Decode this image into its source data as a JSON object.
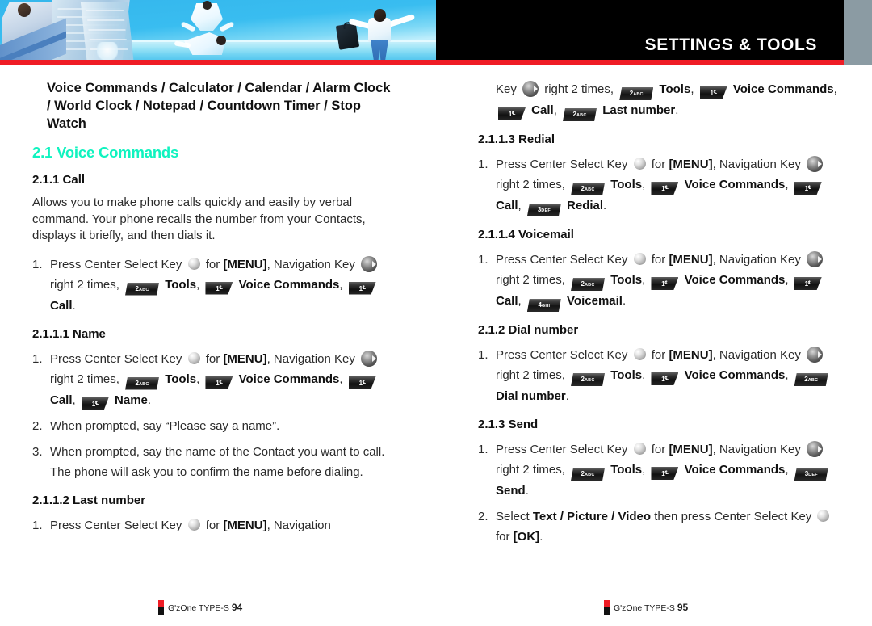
{
  "header": {
    "section_title": "SETTINGS & TOOLS",
    "accent_red": "#ef1c25",
    "band_black": "#000000",
    "band_gray": "#8b9ba3"
  },
  "theme": {
    "heading_green": "#0ff3bf",
    "body_text": "#2b2b2b"
  },
  "left_column": {
    "intro": "Voice Commands / Calculator / Calendar / Alarm Clock  / World Clock / Notepad / Countdown Timer / Stop Watch",
    "section_heading": "2.1 Voice Commands",
    "call": {
      "heading": "2.1.1 Call",
      "description": "Allows you to make phone calls quickly and easily by verbal command. Your phone recalls the number from your Contacts, displays it briefly, and then dials it.",
      "step1": {
        "num": "1.",
        "t1": "Press Center Select Key",
        "t2": "for",
        "menu": "[MENU]",
        "t3": ", Navigation Key",
        "t4": "right 2 times,",
        "k_tools": "Tools",
        "k_voice": "Voice Commands",
        "k_call": "Call",
        "end": "."
      }
    },
    "name": {
      "heading": "2.1.1.1 Name",
      "step1": {
        "num": "1.",
        "t1": "Press Center Select Key",
        "t2": "for",
        "menu": "[MENU]",
        "t3": ", Navigation Key",
        "t4": "right 2 times,",
        "k_tools": "Tools",
        "k_voice": "Voice Commands",
        "k_call": "Call",
        "k_name": "Name",
        "end": "."
      },
      "step2": {
        "num": "2.",
        "text": "When prompted, say “Please say a name”."
      },
      "step3": {
        "num": "3.",
        "text": "When prompted, say the name of the Contact you want to call. The phone will ask you to confirm the name before dialing."
      }
    },
    "last_number": {
      "heading": "2.1.1.2 Last number",
      "step1": {
        "num": "1.",
        "t1": "Press Center Select Key",
        "t2": "for",
        "menu": "[MENU]",
        "t3": ", Navigation"
      }
    }
  },
  "right_column": {
    "last_number_cont": {
      "t_key": "Key",
      "t4": "right 2 times,",
      "k_tools": "Tools",
      "k_voice": "Voice Commands",
      "k_call": "Call",
      "k_last": "Last number",
      "end": "."
    },
    "redial": {
      "heading": "2.1.1.3 Redial",
      "step1": {
        "num": "1.",
        "t1": "Press Center Select Key",
        "t2": "for",
        "menu": "[MENU]",
        "t3": ", Navigation Key",
        "t4": "right 2 times,",
        "k_tools": "Tools",
        "k_voice": "Voice Commands",
        "k_call": "Call",
        "k_redial": "Redial",
        "end": "."
      }
    },
    "voicemail": {
      "heading": "2.1.1.4 Voicemail",
      "step1": {
        "num": "1.",
        "t1": "Press Center Select Key",
        "t2": "for",
        "menu": "[MENU]",
        "t3": ", Navigation Key",
        "t4": "right 2 times,",
        "k_tools": "Tools",
        "k_voice": "Voice Commands",
        "k_call": "Call",
        "k_voicemail": "Voicemail",
        "end": "."
      }
    },
    "dial_number": {
      "heading": "2.1.2 Dial number",
      "step1": {
        "num": "1.",
        "t1": "Press Center Select Key",
        "t2": "for",
        "menu": "[MENU]",
        "t3": ", Navigation Key",
        "t4": "right 2 times,",
        "k_tools": "Tools",
        "k_voice": "Voice Commands",
        "k_dial": "Dial number",
        "end": "."
      }
    },
    "send": {
      "heading": "2.1.3 Send",
      "step1": {
        "num": "1.",
        "t1": "Press Center Select Key",
        "t2": "for",
        "menu": "[MENU]",
        "t3": ", Navigation Key",
        "t4": "right 2 times,",
        "k_tools": "Tools",
        "k_voice": "Voice Commands",
        "k_send": "Send",
        "end": "."
      },
      "step2": {
        "num": "2.",
        "t1": "Select",
        "bold": "Text / Picture / Video",
        "t2": "then press Center Select Key",
        "t3": "for",
        "ok": "[OK]",
        "end": "."
      }
    }
  },
  "keys": {
    "k1": {
      "digit": "1",
      "sub": "℄",
      "name": "keypad-1"
    },
    "k2": {
      "digit": "2",
      "sub": "ABC",
      "name": "keypad-2-abc"
    },
    "k3": {
      "digit": "3",
      "sub": "DEF",
      "name": "keypad-3-def"
    },
    "k4": {
      "digit": "4",
      "sub": "GHI",
      "name": "keypad-4-ghi"
    }
  },
  "footer": {
    "left": {
      "brand": "G'zOne TYPE-S",
      "page": "94"
    },
    "right": {
      "brand": "G'zOne TYPE-S",
      "page": "95"
    }
  }
}
